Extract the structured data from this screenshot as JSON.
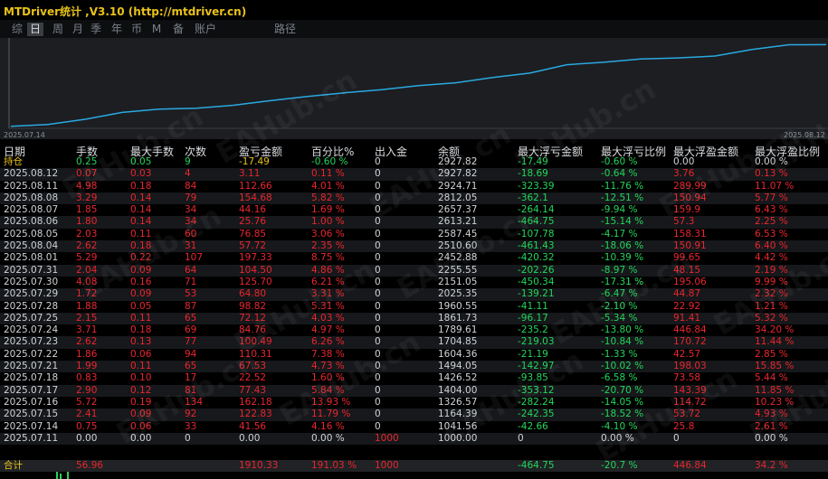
{
  "app": {
    "title": "MTDriver统计 ,V3.10 (http://mtdriver.cn)"
  },
  "toolbar": {
    "items": [
      "综",
      "日",
      "周",
      "月",
      "季",
      "年",
      "币",
      "M",
      "备",
      "账户",
      "路径"
    ],
    "active_index": 1
  },
  "colors": {
    "line": "#2aa9e0",
    "profit": "#e8262e",
    "loss": "#23d65a",
    "accent": "#e8c21a",
    "header": "#d9dce0"
  },
  "chart": {
    "start_label": "2025.07.14",
    "end_label": "2025.08.12"
  },
  "table": {
    "columns": [
      "日期",
      "手数",
      "最大手数",
      "次数",
      "盈亏金额",
      "百分比%",
      "出入金",
      "余额",
      "最大浮亏金额",
      "最大浮亏比例",
      "最大浮盈金额",
      "最大浮盈比例"
    ],
    "position_row": [
      "持仓",
      "0.25",
      "0.05",
      "9",
      "-17.49",
      "-0.60 %",
      "0",
      "2927.82",
      "-17.49",
      "-0.60 %",
      "0.00",
      "0.00 %"
    ],
    "rows": [
      [
        "2025.08.12",
        "0.07",
        "0.03",
        "4",
        "3.11",
        "0.11 %",
        "0",
        "2927.82",
        "-18.69",
        "-0.64 %",
        "3.76",
        "0.13 %"
      ],
      [
        "2025.08.11",
        "4.98",
        "0.18",
        "84",
        "112.66",
        "4.01 %",
        "0",
        "2924.71",
        "-323.39",
        "-11.76 %",
        "289.99",
        "11.07 %"
      ],
      [
        "2025.08.08",
        "3.29",
        "0.14",
        "79",
        "154.68",
        "5.82 %",
        "0",
        "2812.05",
        "-362.1",
        "-12.51 %",
        "150.94",
        "5.77 %"
      ],
      [
        "2025.08.07",
        "1.85",
        "0.14",
        "34",
        "44.16",
        "1.69 %",
        "0",
        "2657.37",
        "-264.14",
        "-9.94 %",
        "159.9",
        "6.43 %"
      ],
      [
        "2025.08.06",
        "1.80",
        "0.14",
        "34",
        "25.76",
        "1.00 %",
        "0",
        "2613.21",
        "-464.75",
        "-15.14 %",
        "57.3",
        "2.25 %"
      ],
      [
        "2025.08.05",
        "2.03",
        "0.11",
        "60",
        "76.85",
        "3.06 %",
        "0",
        "2587.45",
        "-107.78",
        "-4.17 %",
        "158.31",
        "6.53 %"
      ],
      [
        "2025.08.04",
        "2.62",
        "0.18",
        "31",
        "57.72",
        "2.35 %",
        "0",
        "2510.60",
        "-461.43",
        "-18.06 %",
        "150.91",
        "6.40 %"
      ],
      [
        "2025.08.01",
        "5.29",
        "0.22",
        "107",
        "197.33",
        "8.75 %",
        "0",
        "2452.88",
        "-420.32",
        "-10.39 %",
        "99.65",
        "4.42 %"
      ],
      [
        "2025.07.31",
        "2.04",
        "0.09",
        "64",
        "104.50",
        "4.86 %",
        "0",
        "2255.55",
        "-202.26",
        "-8.97 %",
        "48.15",
        "2.19 %"
      ],
      [
        "2025.07.30",
        "4.08",
        "0.16",
        "71",
        "125.70",
        "6.21 %",
        "0",
        "2151.05",
        "-450.34",
        "-17.31 %",
        "195.06",
        "9.99 %"
      ],
      [
        "2025.07.29",
        "1.72",
        "0.09",
        "53",
        "64.80",
        "3.31 %",
        "0",
        "2025.35",
        "-139.21",
        "-6.47 %",
        "44.87",
        "2.32 %"
      ],
      [
        "2025.07.28",
        "1.88",
        "0.05",
        "87",
        "98.82",
        "5.31 %",
        "0",
        "1960.55",
        "-41.11",
        "-2.10 %",
        "22.92",
        "1.21 %"
      ],
      [
        "2025.07.25",
        "2.15",
        "0.11",
        "65",
        "72.12",
        "4.03 %",
        "0",
        "1861.73",
        "-96.17",
        "-5.34 %",
        "91.41",
        "5.32 %"
      ],
      [
        "2025.07.24",
        "3.71",
        "0.18",
        "69",
        "84.76",
        "4.97 %",
        "0",
        "1789.61",
        "-235.2",
        "-13.80 %",
        "446.84",
        "34.20 %"
      ],
      [
        "2025.07.23",
        "2.62",
        "0.13",
        "77",
        "100.49",
        "6.26 %",
        "0",
        "1704.85",
        "-219.03",
        "-10.84 %",
        "170.72",
        "11.44 %"
      ],
      [
        "2025.07.22",
        "1.86",
        "0.06",
        "94",
        "110.31",
        "7.38 %",
        "0",
        "1604.36",
        "-21.19",
        "-1.33 %",
        "42.57",
        "2.85 %"
      ],
      [
        "2025.07.21",
        "1.99",
        "0.11",
        "65",
        "67.53",
        "4.73 %",
        "0",
        "1494.05",
        "-142.97",
        "-10.02 %",
        "198.03",
        "15.85 %"
      ],
      [
        "2025.07.18",
        "0.83",
        "0.10",
        "17",
        "22.52",
        "1.60 %",
        "0",
        "1426.52",
        "-93.85",
        "-6.58 %",
        "73.58",
        "5.44 %"
      ],
      [
        "2025.07.17",
        "2.90",
        "0.12",
        "81",
        "77.43",
        "5.84 %",
        "0",
        "1404.00",
        "-353.12",
        "-20.70 %",
        "143.39",
        "11.85 %"
      ],
      [
        "2025.07.16",
        "5.72",
        "0.19",
        "134",
        "162.18",
        "13.93 %",
        "0",
        "1326.57",
        "-282.24",
        "-14.05 %",
        "114.72",
        "10.23 %"
      ],
      [
        "2025.07.15",
        "2.41",
        "0.09",
        "92",
        "122.83",
        "11.79 %",
        "0",
        "1164.39",
        "-242.35",
        "-18.52 %",
        "53.72",
        "4.93 %"
      ],
      [
        "2025.07.14",
        "0.75",
        "0.06",
        "33",
        "41.56",
        "4.16 %",
        "0",
        "1041.56",
        "-42.66",
        "-4.10 %",
        "25.8",
        "2.61 %"
      ],
      [
        "2025.07.11",
        "0.00",
        "0.00",
        "0",
        "0.00",
        "0.00 %",
        "1000",
        "1000.00",
        "0",
        "0.00 %",
        "0",
        "0.00 %"
      ]
    ],
    "total_row": [
      "合计",
      "56.96",
      "",
      "",
      "1910.33",
      "191.03 %",
      "1000",
      "",
      "-464.75",
      "-20.7 %",
      "446.84",
      "34.2 %"
    ]
  },
  "watermark": "EAHub.cn"
}
